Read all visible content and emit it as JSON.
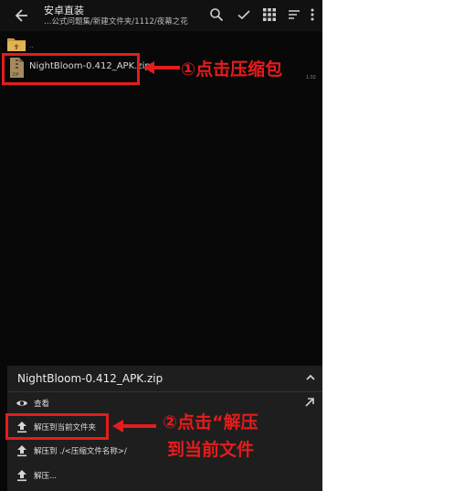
{
  "app_bar": {
    "title": "安卓直装",
    "path": "…公式问题集/新建文件夹/1112/夜幕之花"
  },
  "file_list": {
    "parent_folder_label": "..",
    "files": [
      {
        "name": "NightBloom-0.412_APK.zip",
        "size": "1.02"
      }
    ]
  },
  "bottom_sheet": {
    "title": "NightBloom-0.412_APK.zip",
    "items": [
      {
        "label": "查看",
        "icon": "eye-icon"
      },
      {
        "label": "解压到当前文件夹",
        "icon": "upload-icon"
      },
      {
        "label": "解压到 ./<压缩文件名称>/",
        "icon": "upload-icon"
      },
      {
        "label": "解压...",
        "icon": "upload-icon"
      }
    ]
  },
  "annotations": {
    "step1": "①点击压缩包",
    "step2_line1": "②点击“解压",
    "step2_line2": "到当前文件"
  },
  "colors": {
    "annotation_red": "#e51c1c",
    "background": "#080808",
    "sheet_background": "#1e1e1e"
  }
}
